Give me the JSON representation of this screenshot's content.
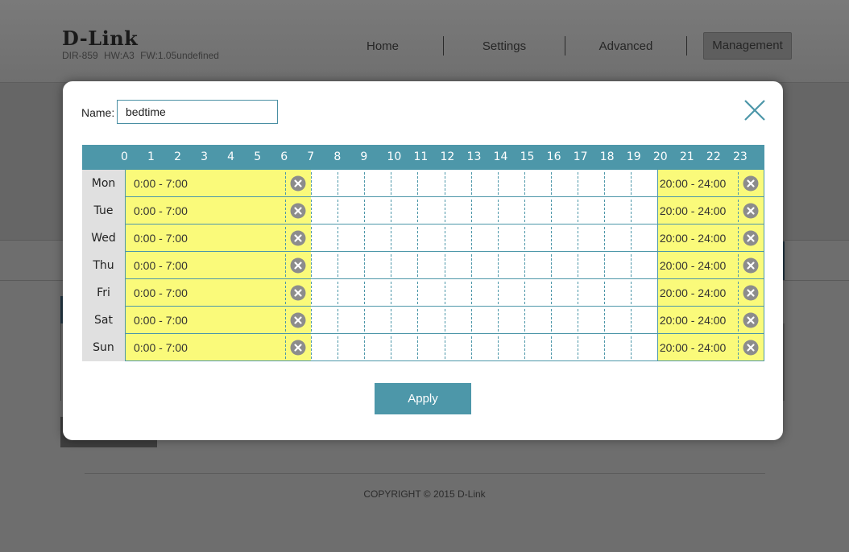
{
  "header": {
    "logo": "D-Link",
    "device": "DIR-859   HW:A3   FW:1.05undefined",
    "nav": [
      "Home",
      "Settings",
      "Advanced",
      "Management"
    ],
    "active_nav": "Management"
  },
  "footer": {
    "copyright": "COPYRIGHT © 2015 D-Link"
  },
  "modal": {
    "name_label": "Name:",
    "name_value": "bedtime",
    "close_icon": "close-icon",
    "hours": [
      "0",
      "1",
      "2",
      "3",
      "4",
      "5",
      "6",
      "7",
      "8",
      "9",
      "10",
      "11",
      "12",
      "13",
      "14",
      "15",
      "16",
      "17",
      "18",
      "19",
      "20",
      "21",
      "22",
      "23"
    ],
    "days": [
      {
        "label": "Mon",
        "blocks": [
          {
            "start": 0,
            "end": 7,
            "text": "0:00 - 7:00"
          },
          {
            "start": 20,
            "end": 24,
            "text": "20:00 - 24:00"
          }
        ]
      },
      {
        "label": "Tue",
        "blocks": [
          {
            "start": 0,
            "end": 7,
            "text": "0:00 - 7:00"
          },
          {
            "start": 20,
            "end": 24,
            "text": "20:00 - 24:00"
          }
        ]
      },
      {
        "label": "Wed",
        "blocks": [
          {
            "start": 0,
            "end": 7,
            "text": "0:00 - 7:00"
          },
          {
            "start": 20,
            "end": 24,
            "text": "20:00 - 24:00"
          }
        ]
      },
      {
        "label": "Thu",
        "blocks": [
          {
            "start": 0,
            "end": 7,
            "text": "0:00 - 7:00"
          },
          {
            "start": 20,
            "end": 24,
            "text": "20:00 - 24:00"
          }
        ]
      },
      {
        "label": "Fri",
        "blocks": [
          {
            "start": 0,
            "end": 7,
            "text": "0:00 - 7:00"
          },
          {
            "start": 20,
            "end": 24,
            "text": "20:00 - 24:00"
          }
        ]
      },
      {
        "label": "Sat",
        "blocks": [
          {
            "start": 0,
            "end": 7,
            "text": "0:00 - 7:00"
          },
          {
            "start": 20,
            "end": 24,
            "text": "20:00 - 24:00"
          }
        ]
      },
      {
        "label": "Sun",
        "blocks": [
          {
            "start": 0,
            "end": 7,
            "text": "0:00 - 7:00"
          },
          {
            "start": 20,
            "end": 24,
            "text": "20:00 - 24:00"
          }
        ]
      }
    ],
    "apply_label": "Apply"
  },
  "colors": {
    "accent": "#4d97a9",
    "block_fill": "#fafa7a",
    "day_label_bg": "#e0e0e0"
  }
}
